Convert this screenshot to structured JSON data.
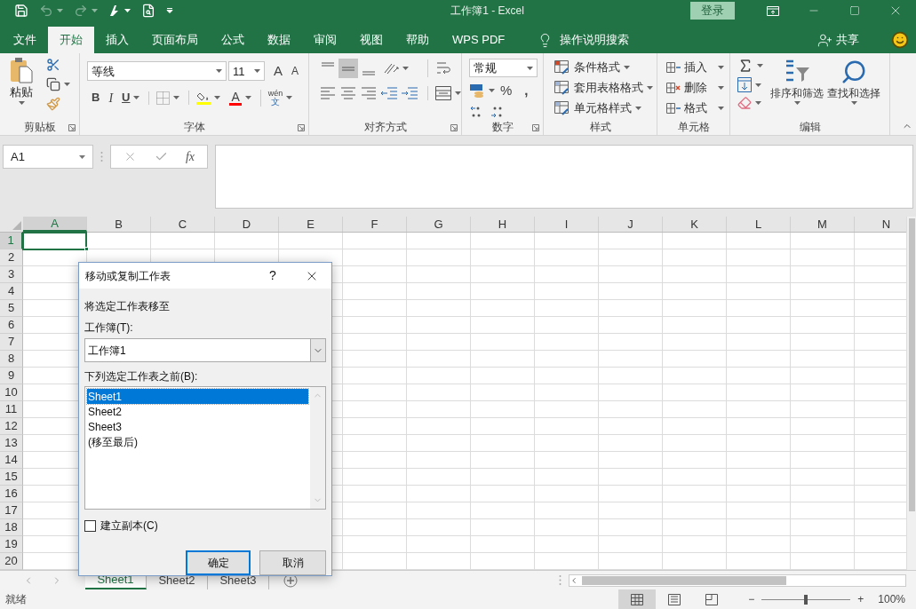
{
  "title_bar": {
    "title": "工作簿1 - Excel",
    "sign_in": "登录"
  },
  "tabs": [
    {
      "label": "文件",
      "selected": false
    },
    {
      "label": "开始",
      "selected": true
    },
    {
      "label": "插入",
      "selected": false
    },
    {
      "label": "页面布局",
      "selected": false
    },
    {
      "label": "公式",
      "selected": false
    },
    {
      "label": "数据",
      "selected": false
    },
    {
      "label": "审阅",
      "selected": false
    },
    {
      "label": "视图",
      "selected": false
    },
    {
      "label": "帮助",
      "selected": false
    },
    {
      "label": "WPS PDF",
      "selected": false
    }
  ],
  "tell_me": "操作说明搜索",
  "share": "共享",
  "ribbon": {
    "clipboard": {
      "label": "剪贴板",
      "paste": "粘贴"
    },
    "font": {
      "label": "字体",
      "font_name": "等线",
      "font_size": "11",
      "grow": "A",
      "shrink": "A",
      "bold": "B",
      "italic": "I",
      "underline": "U",
      "font_color": "A",
      "phonetic_top": "wén",
      "phonetic_bottom": "文"
    },
    "alignment": {
      "label": "对齐方式",
      "vertical_buttons": [
        {
          "selected": false
        },
        {
          "selected": true
        },
        {
          "selected": false
        }
      ]
    },
    "number": {
      "label": "数字",
      "format": "常规",
      "percent": "%",
      "comma": ","
    },
    "styles": {
      "label": "样式",
      "items": [
        "条件格式",
        "套用表格格式",
        "单元格样式"
      ]
    },
    "cells": {
      "label": "单元格",
      "items": [
        "插入",
        "删除",
        "格式"
      ]
    },
    "editing": {
      "label": "编辑",
      "sort_filter": "排序和筛选",
      "find_select": "查找和选择"
    }
  },
  "formula_bar": {
    "name_box": "A1",
    "function_label": "fx"
  },
  "sheet": {
    "columns": [
      {
        "label": "A",
        "selected": true
      },
      {
        "label": "B",
        "selected": false
      },
      {
        "label": "C",
        "selected": false
      },
      {
        "label": "D",
        "selected": false
      },
      {
        "label": "E",
        "selected": false
      },
      {
        "label": "F",
        "selected": false
      },
      {
        "label": "G",
        "selected": false
      },
      {
        "label": "H",
        "selected": false
      },
      {
        "label": "I",
        "selected": false
      },
      {
        "label": "J",
        "selected": false
      },
      {
        "label": "K",
        "selected": false
      },
      {
        "label": "L",
        "selected": false
      },
      {
        "label": "M",
        "selected": false
      },
      {
        "label": "N",
        "selected": false
      }
    ],
    "rows": [
      {
        "label": "1",
        "selected": true
      },
      {
        "label": "2",
        "selected": false
      },
      {
        "label": "3",
        "selected": false
      },
      {
        "label": "4",
        "selected": false
      },
      {
        "label": "5",
        "selected": false
      },
      {
        "label": "6",
        "selected": false
      },
      {
        "label": "7",
        "selected": false
      },
      {
        "label": "8",
        "selected": false
      },
      {
        "label": "9",
        "selected": false
      },
      {
        "label": "10",
        "selected": false
      },
      {
        "label": "11",
        "selected": false
      },
      {
        "label": "12",
        "selected": false
      },
      {
        "label": "13",
        "selected": false
      },
      {
        "label": "14",
        "selected": false
      },
      {
        "label": "15",
        "selected": false
      },
      {
        "label": "16",
        "selected": false
      },
      {
        "label": "17",
        "selected": false
      },
      {
        "label": "18",
        "selected": false
      },
      {
        "label": "19",
        "selected": false
      },
      {
        "label": "20",
        "selected": false
      }
    ]
  },
  "sheet_tabs": [
    {
      "label": "Sheet1",
      "selected": true
    },
    {
      "label": "Sheet2",
      "selected": false
    },
    {
      "label": "Sheet3",
      "selected": false
    }
  ],
  "status": {
    "text": "就绪",
    "views": [
      {
        "selected": true
      },
      {
        "selected": false
      },
      {
        "selected": false
      }
    ],
    "zoom_out": "−",
    "zoom_in": "+",
    "zoom_slider": {
      "level": 0.5
    },
    "zoom": "100%"
  },
  "dialog": {
    "title": "移动或复制工作表",
    "help": "?",
    "heading": "将选定工作表移至",
    "workbook_label": "工作簿(T):",
    "workbook_value": "工作簿1",
    "before_label": "下列选定工作表之前(B):",
    "sheets": [
      {
        "label": "Sheet1",
        "selected": true
      },
      {
        "label": "Sheet2",
        "selected": false
      },
      {
        "label": "Sheet3",
        "selected": false
      },
      {
        "label": "(移至最后)",
        "selected": false
      }
    ],
    "copy": {
      "label": "建立副本(C)",
      "checked": false
    },
    "ok": "确定",
    "cancel": "取消"
  }
}
